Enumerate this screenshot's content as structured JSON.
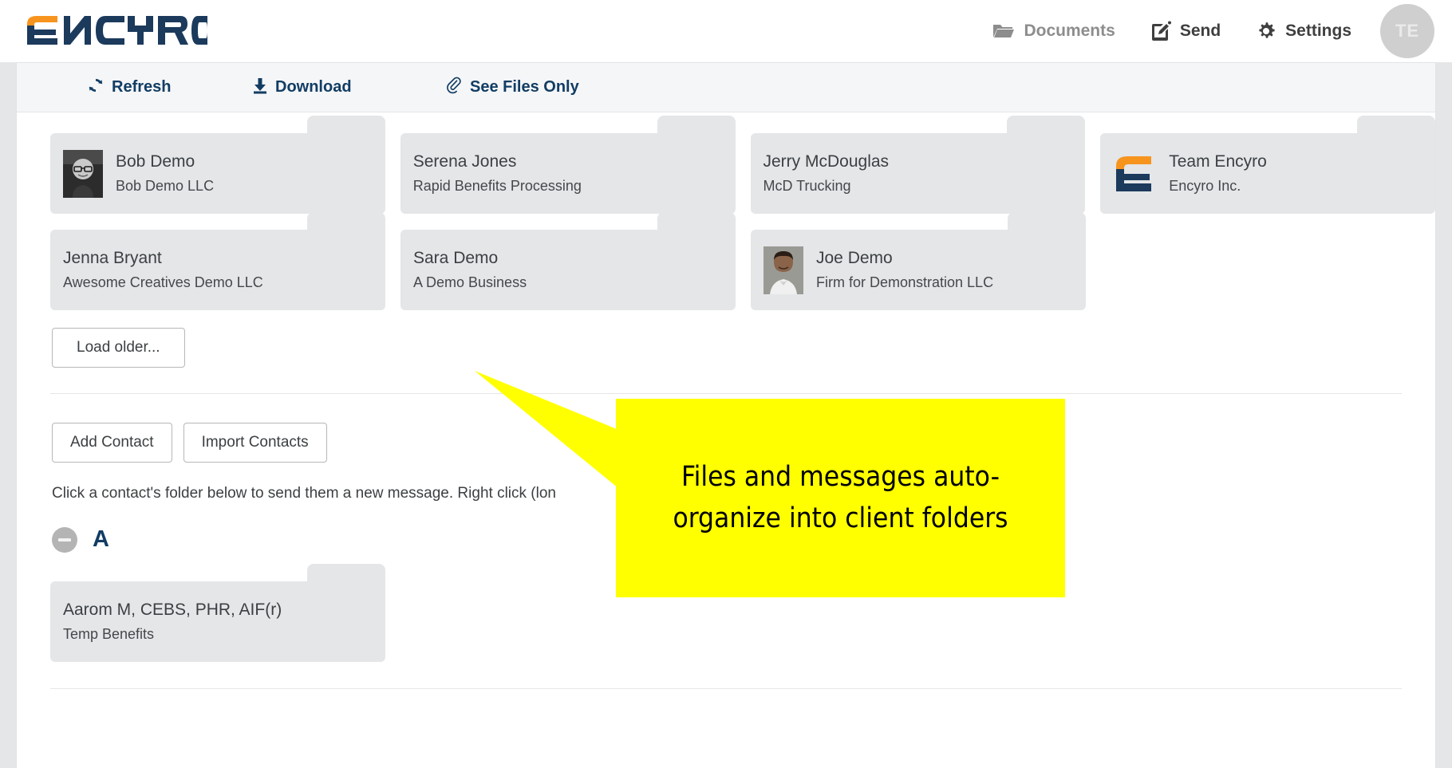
{
  "header": {
    "logo_text": "ENCYRO",
    "logo_colors": {
      "orange": "#F7941E",
      "navy": "#1B3A5C"
    },
    "nav": [
      {
        "label": "Documents",
        "icon": "folder-open-icon",
        "muted": true
      },
      {
        "label": "Send",
        "icon": "compose-icon",
        "muted": false
      },
      {
        "label": "Settings",
        "icon": "gear-icon",
        "muted": false
      }
    ],
    "avatar_initials": "TE"
  },
  "toolbar": {
    "refresh_label": "Refresh",
    "download_label": "Download",
    "see_files_label": "See Files Only"
  },
  "recent_folders": [
    [
      {
        "name": "Bob Demo",
        "org": "Bob Demo LLC",
        "avatar": "photo-bob",
        "has_tab": true
      },
      {
        "name": "Serena Jones",
        "org": "Rapid Benefits Processing",
        "avatar": null,
        "has_tab": true
      },
      {
        "name": "Jerry McDouglas",
        "org": "McD Trucking",
        "avatar": null,
        "has_tab": true
      },
      {
        "name": "Team Encyro",
        "org": "Encyro Inc.",
        "avatar": "logo-encyro",
        "has_tab": true
      }
    ],
    [
      {
        "name": "Jenna Bryant",
        "org": "Awesome Creatives Demo LLC",
        "avatar": null,
        "has_tab": true
      },
      {
        "name": "Sara Demo",
        "org": "A Demo Business",
        "avatar": null,
        "has_tab": true
      },
      {
        "name": "Joe Demo",
        "org": "Firm for Demonstration LLC",
        "avatar": "photo-joe",
        "has_tab": true
      }
    ]
  ],
  "load_older_label": "Load older...",
  "contact_actions": {
    "add_label": "Add Contact",
    "import_label": "Import Contacts"
  },
  "hint_text": "Click a contact's folder below to send them a new message. Right click (lon",
  "alpha_section": {
    "collapse_icon": "minus-circle-icon",
    "letter": "A",
    "folders": [
      {
        "name": "Aarom M, CEBS, PHR, AIF(r)",
        "org": "Temp Benefits",
        "avatar": null,
        "has_tab": true
      }
    ]
  },
  "callout": {
    "text": "Files and messages auto-organize into client folders",
    "background": "#ffff00",
    "text_color": "#000000"
  }
}
